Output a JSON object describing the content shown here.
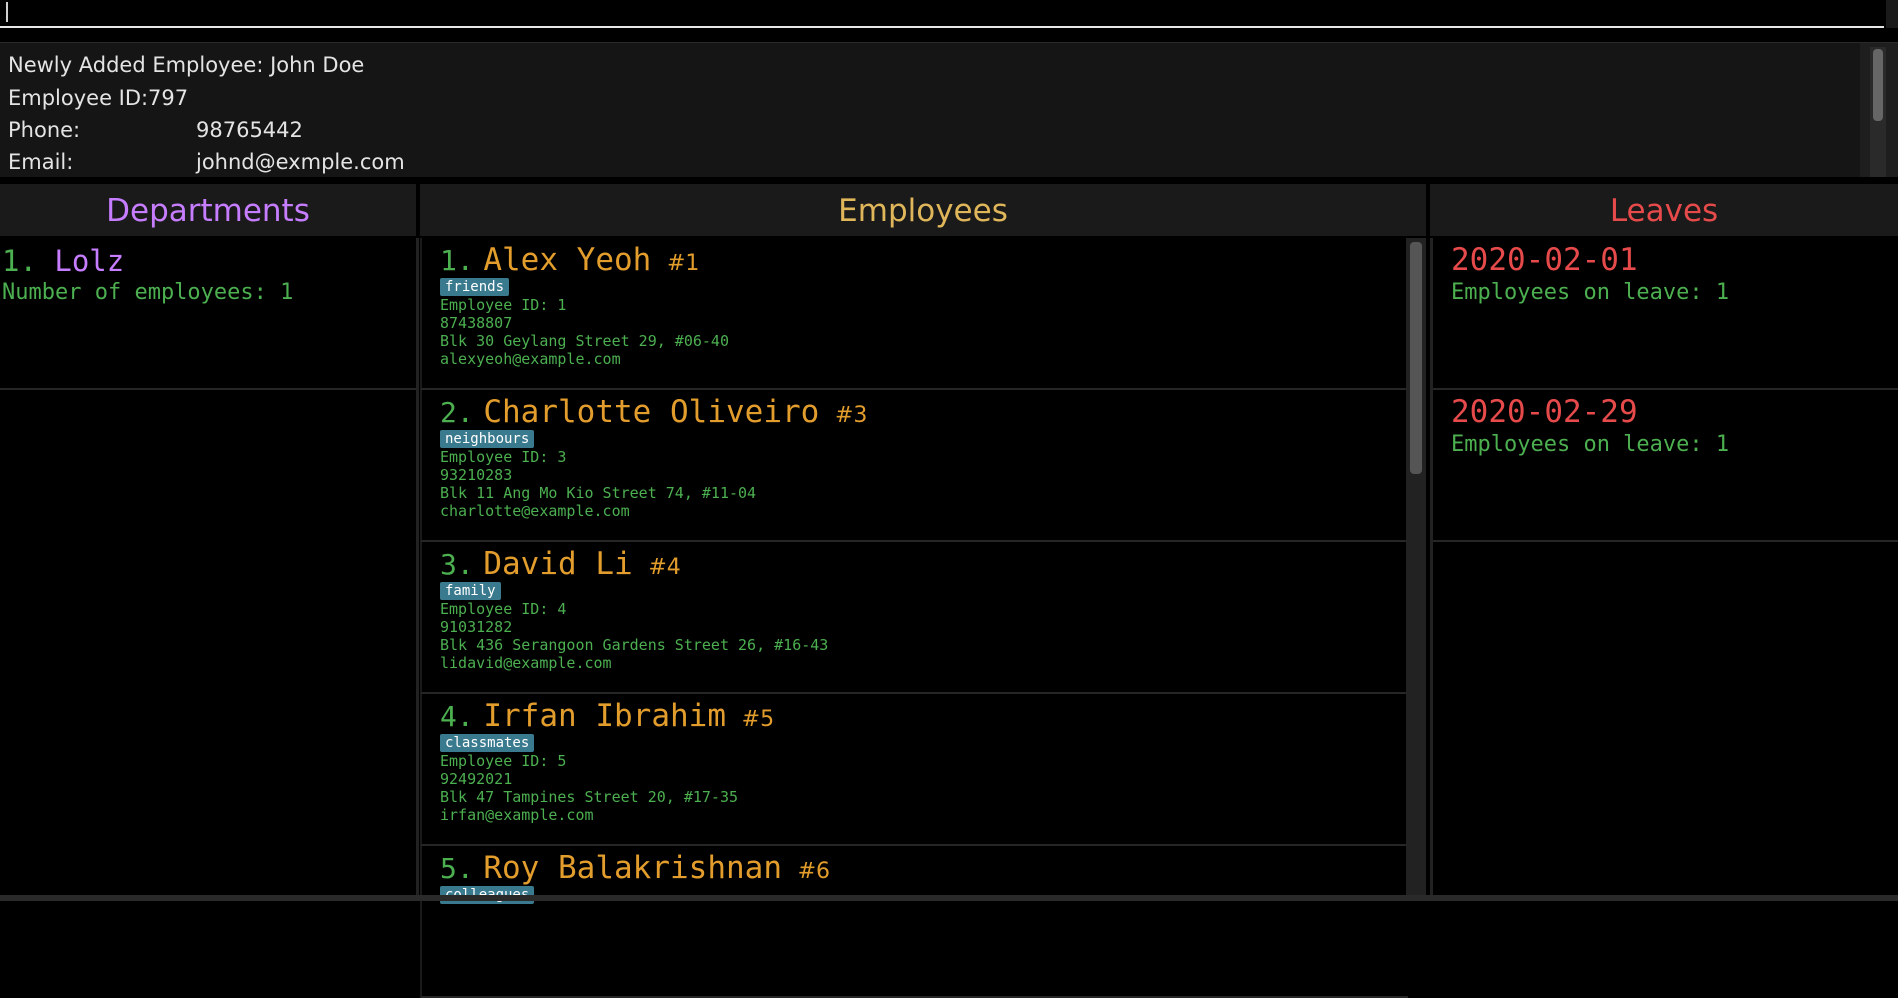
{
  "command_box": {
    "value": ""
  },
  "result": {
    "line1": "Newly Added Employee: John Doe",
    "id_label": "Employee ID:",
    "id_value": "797",
    "phone_label": "Phone:",
    "phone_value": "98765442",
    "email_label": "Email:",
    "email_value": "johnd@exmple.com"
  },
  "panels": {
    "departments": "Departments",
    "employees": "Employees",
    "leaves": "Leaves"
  },
  "departments": [
    {
      "index": "1.",
      "name": "Lolz",
      "count": "Number of employees: 1"
    }
  ],
  "employees": [
    {
      "index": "1.",
      "name": "Alex Yeoh",
      "hash": "#1",
      "tag": "friends",
      "id": "Employee ID: 1",
      "phone": "87438807",
      "address": "Blk 30 Geylang Street 29, #06-40",
      "email": "alexyeoh@example.com"
    },
    {
      "index": "2.",
      "name": "Charlotte Oliveiro",
      "hash": "#3",
      "tag": "neighbours",
      "id": "Employee ID: 3",
      "phone": "93210283",
      "address": "Blk 11 Ang Mo Kio Street 74, #11-04",
      "email": "charlotte@example.com"
    },
    {
      "index": "3.",
      "name": "David Li",
      "hash": "#4",
      "tag": "family",
      "id": "Employee ID: 4",
      "phone": "91031282",
      "address": "Blk 436 Serangoon Gardens Street 26, #16-43",
      "email": "lidavid@example.com"
    },
    {
      "index": "4.",
      "name": "Irfan Ibrahim",
      "hash": "#5",
      "tag": "classmates",
      "id": "Employee ID: 5",
      "phone": "92492021",
      "address": "Blk 47 Tampines Street 20, #17-35",
      "email": "irfan@example.com"
    },
    {
      "index": "5.",
      "name": "Roy Balakrishnan",
      "hash": "#6",
      "tag": "colleagues"
    }
  ],
  "leaves": [
    {
      "date": "2020-02-01",
      "count": "Employees on leave: 1"
    },
    {
      "date": "2020-02-29",
      "count": "Employees on leave: 1"
    }
  ],
  "colors": {
    "departments": "#c77dff",
    "employees": "#e0b65a",
    "leaves": "#e64a4a",
    "text_green": "#4caf50",
    "tag_bg": "#3a7a8f"
  }
}
